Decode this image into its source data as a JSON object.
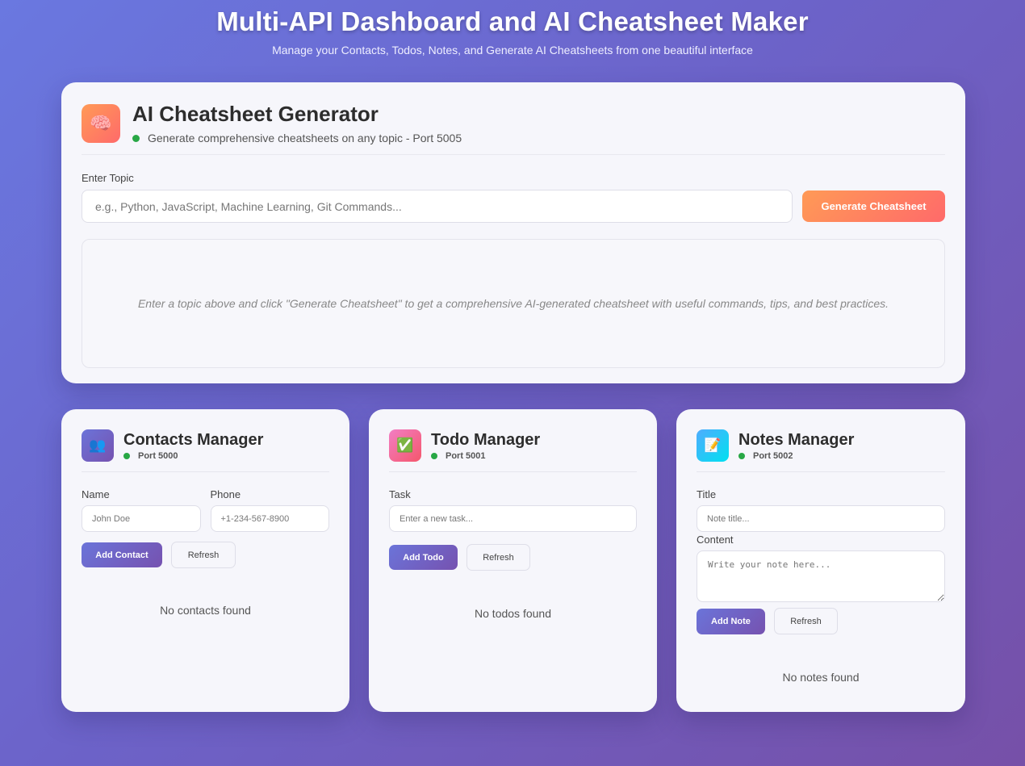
{
  "header": {
    "title": "Multi-API Dashboard and AI Cheatsheet Maker",
    "subtitle": "Manage your Contacts, Todos, Notes, and Generate AI Cheatsheets from one beautiful interface"
  },
  "ai": {
    "icon": "brain-icon",
    "icon_glyph": "🧠",
    "title": "AI Cheatsheet Generator",
    "status": "Generate comprehensive cheatsheets on any topic - Port 5005",
    "topic_label": "Enter Topic",
    "topic_placeholder": "e.g., Python, JavaScript, Machine Learning, Git Commands...",
    "generate_label": "Generate Cheatsheet",
    "placeholder_text": "Enter a topic above and click \"Generate Cheatsheet\" to get a comprehensive AI-generated cheatsheet with useful commands, tips, and best practices."
  },
  "contacts": {
    "icon": "people-icon",
    "icon_glyph": "👥",
    "title": "Contacts Manager",
    "port": "Port 5000",
    "name_label": "Name",
    "name_placeholder": "John Doe",
    "phone_label": "Phone",
    "phone_placeholder": "+1-234-567-8900",
    "add_label": "Add Contact",
    "refresh_label": "Refresh",
    "empty": "No contacts found"
  },
  "todos": {
    "icon": "checkbox-icon",
    "icon_glyph": "✅",
    "title": "Todo Manager",
    "port": "Port 5001",
    "task_label": "Task",
    "task_placeholder": "Enter a new task...",
    "add_label": "Add Todo",
    "refresh_label": "Refresh",
    "empty": "No todos found"
  },
  "notes": {
    "icon": "memo-icon",
    "icon_glyph": "📝",
    "title": "Notes Manager",
    "port": "Port 5002",
    "title_label": "Title",
    "title_placeholder": "Note title...",
    "content_label": "Content",
    "content_placeholder": "Write your note here...",
    "add_label": "Add Note",
    "refresh_label": "Refresh",
    "empty": "No notes found"
  },
  "colors": {
    "status_online": "#28a745",
    "accent_orange": "#ff7f5f",
    "accent_purple": "#6e63c6"
  }
}
